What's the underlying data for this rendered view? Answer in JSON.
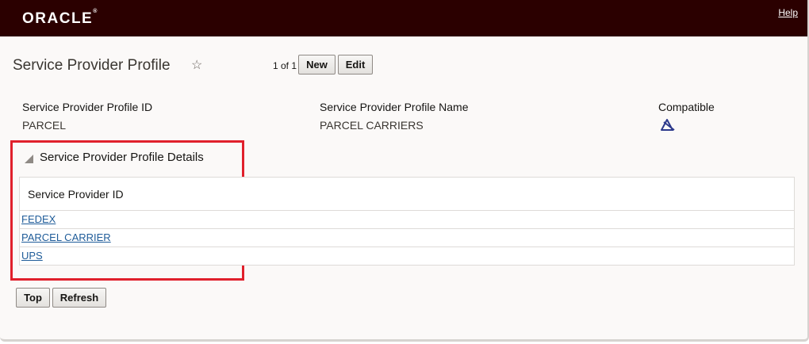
{
  "header": {
    "logo_text": "ORACLE",
    "help_label": "Help"
  },
  "page": {
    "title": "Service Provider Profile",
    "favorite_icon": "star-icon",
    "pager_text": "1 of 1",
    "new_label": "New",
    "edit_label": "Edit"
  },
  "fields": {
    "profile_id_label": "Service Provider Profile ID",
    "profile_id_value": "PARCEL",
    "profile_name_label": "Service Provider Profile Name",
    "profile_name_value": "PARCEL CARRIERS",
    "compatible_label": "Compatible",
    "compatible_icon": "compatible-icon"
  },
  "details": {
    "section_title": "Service Provider Profile Details",
    "column_header": "Service Provider ID",
    "rows": [
      "FEDEX",
      "PARCEL CARRIER",
      "UPS"
    ]
  },
  "footer": {
    "top_label": "Top",
    "refresh_label": "Refresh"
  },
  "colors": {
    "header_bg": "#2b0000",
    "link": "#1f5c99",
    "highlight_border": "#e0202c"
  }
}
